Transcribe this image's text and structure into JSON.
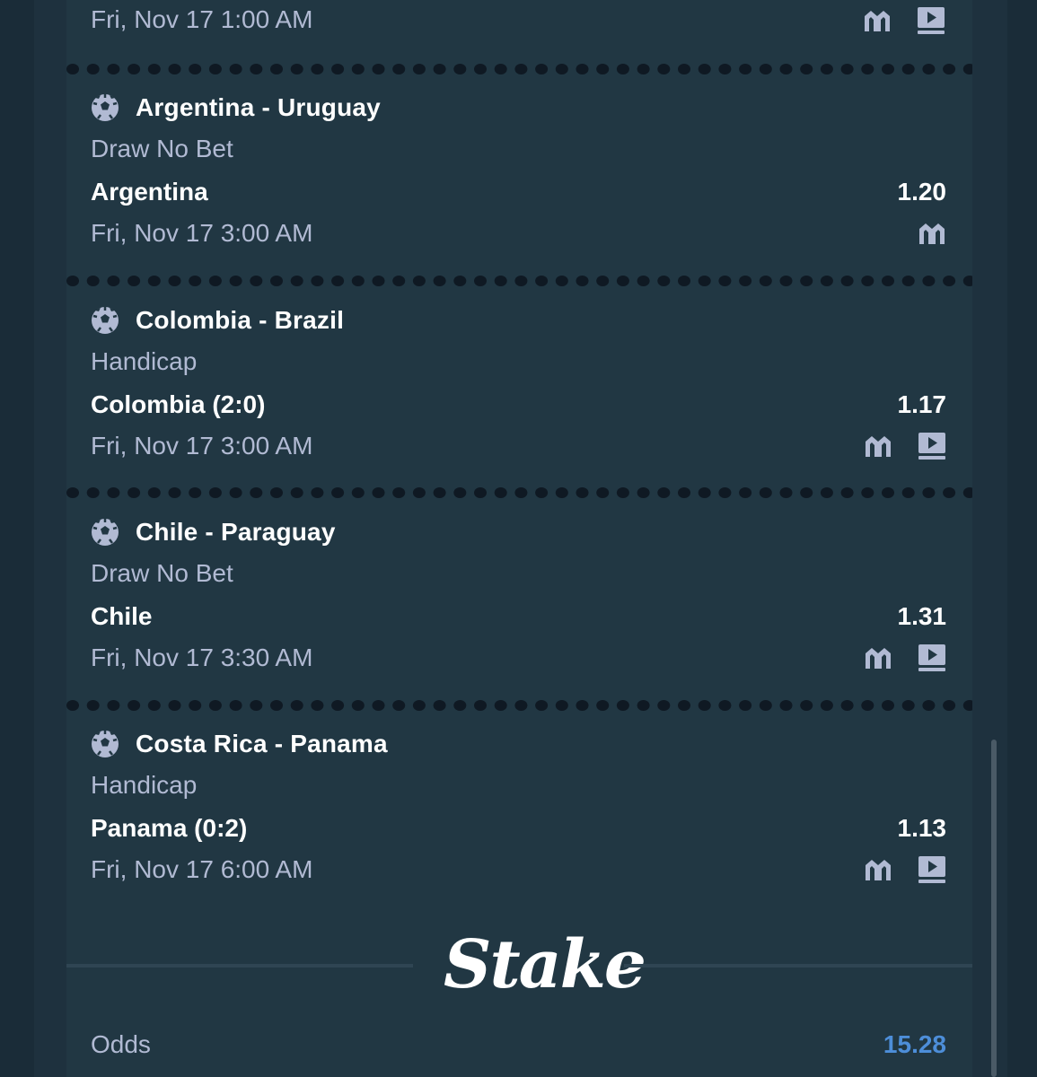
{
  "colors": {
    "background": "#1a2c38",
    "card": "#213743",
    "text_primary": "#ffffff",
    "text_secondary": "#b1bad3",
    "accent_odds": "#4d8ed9"
  },
  "top_partial": {
    "datetime": "Fri, Nov 17 1:00 AM",
    "icons": [
      "stats-icon",
      "play-icon"
    ]
  },
  "bets": [
    {
      "match": "Argentina - Uruguay",
      "market": "Draw No Bet",
      "selection": "Argentina",
      "odds": "1.20",
      "datetime": "Fri, Nov 17 3:00 AM",
      "icons": [
        "stats-icon"
      ]
    },
    {
      "match": "Colombia - Brazil",
      "market": "Handicap",
      "selection": "Colombia (2:0)",
      "odds": "1.17",
      "datetime": "Fri, Nov 17 3:00 AM",
      "icons": [
        "stats-icon",
        "play-icon"
      ]
    },
    {
      "match": "Chile - Paraguay",
      "market": "Draw No Bet",
      "selection": "Chile",
      "odds": "1.31",
      "datetime": "Fri, Nov 17 3:30 AM",
      "icons": [
        "stats-icon",
        "play-icon"
      ]
    },
    {
      "match": "Costa Rica - Panama",
      "market": "Handicap",
      "selection": "Panama (0:2)",
      "odds": "1.13",
      "datetime": "Fri, Nov 17 6:00 AM",
      "icons": [
        "stats-icon",
        "play-icon"
      ]
    }
  ],
  "brand": {
    "logo_text": "Stake"
  },
  "summary": {
    "odds_label": "Odds",
    "odds_value": "15.28"
  }
}
